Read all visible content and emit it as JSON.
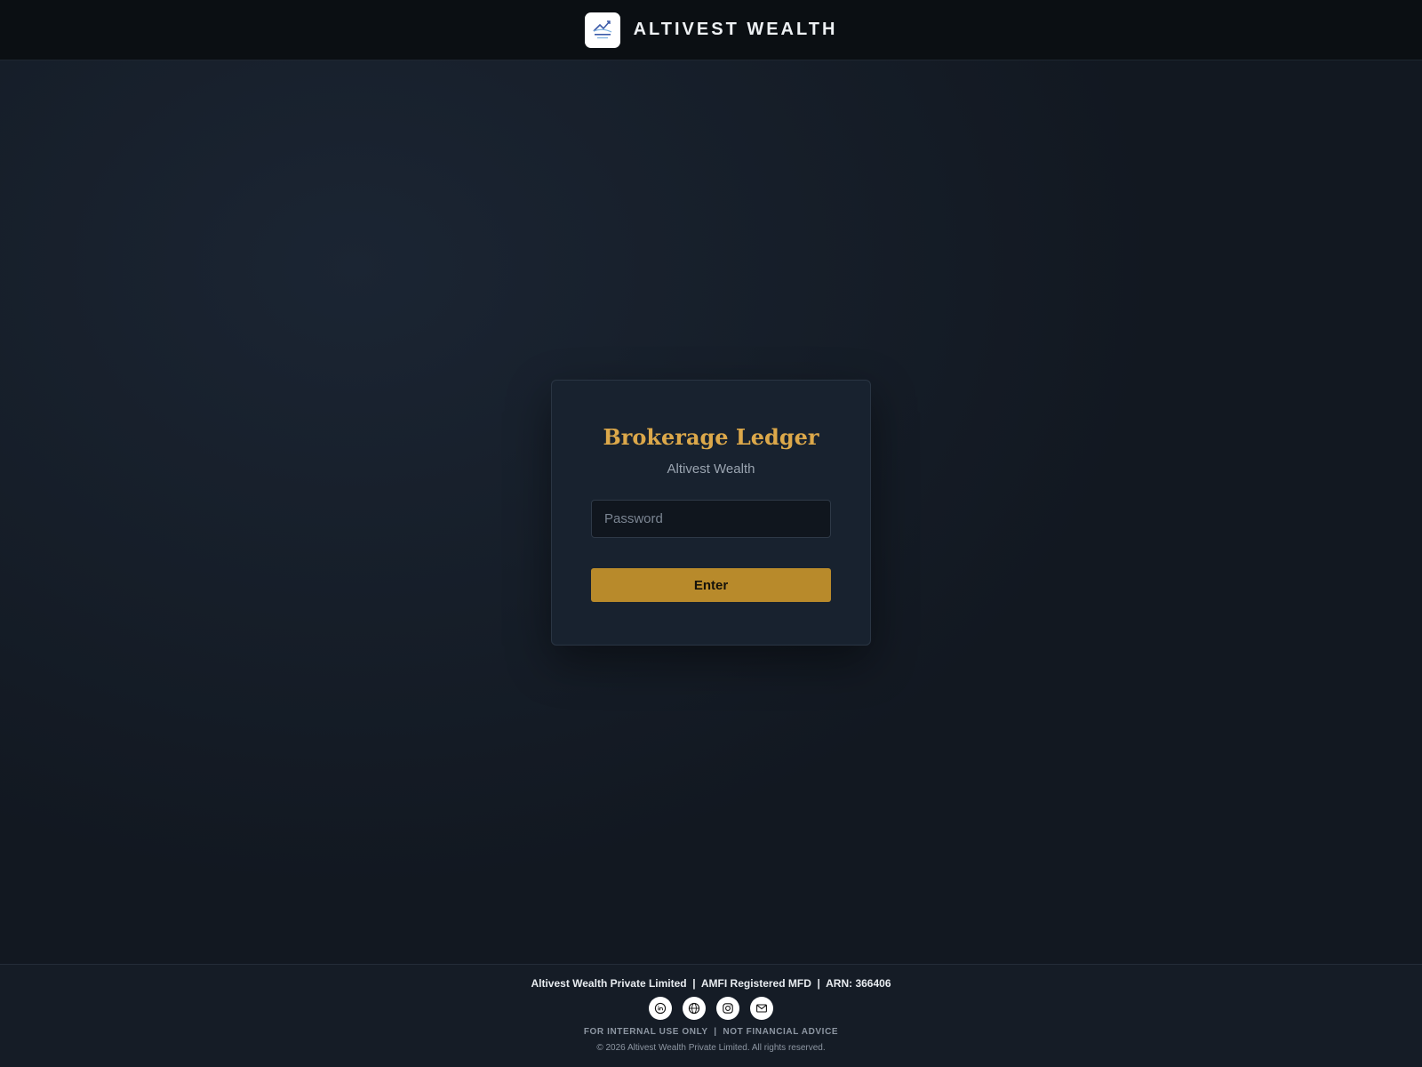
{
  "header": {
    "brand_name": "ALTIVEST WEALTH",
    "logo_icon": "altivest-logo-icon",
    "logo_text": "ALTIVEST wealth"
  },
  "login": {
    "title": "Brokerage Ledger",
    "subtitle": "Altivest Wealth",
    "password_placeholder": "Password",
    "password_value": "",
    "enter_label": "Enter"
  },
  "footer": {
    "company_line": "Altivest Wealth Private Limited  |  AMFI Registered MFD  |  ARN: 366406",
    "social_icons": [
      "linkedin-icon",
      "globe-icon",
      "instagram-icon",
      "mail-icon"
    ],
    "disclaimer": "FOR INTERNAL USE ONLY  |  NOT FINANCIAL ADVICE",
    "copyright": "© 2026 Altivest Wealth Private Limited. All rights reserved."
  },
  "colors": {
    "accent_gold": "#b88a2b",
    "title_gold": "#dca84a",
    "header_bg": "#0b0f13",
    "card_bg": "#18222f"
  }
}
